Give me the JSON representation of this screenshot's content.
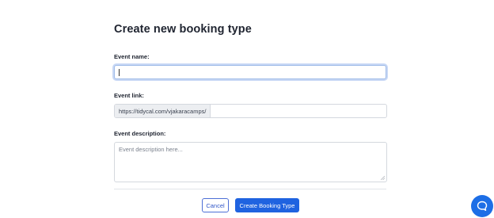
{
  "form": {
    "title": "Create new booking type",
    "event_name": {
      "label": "Event name:",
      "value": ""
    },
    "event_link": {
      "label": "Event link:",
      "prefix": "https://tidycal.com/vjakaracamps/",
      "value": ""
    },
    "event_description": {
      "label": "Event description:",
      "placeholder": "Event description here..."
    },
    "actions": {
      "cancel_label": "Cancel",
      "create_label": "Create Booking Type"
    }
  },
  "chat_widget": {
    "icon": "chat-bubble-icon",
    "color": "#1d6ee6"
  },
  "colors": {
    "primary": "#1f63e0",
    "focus_ring": "#c8d8f5"
  }
}
